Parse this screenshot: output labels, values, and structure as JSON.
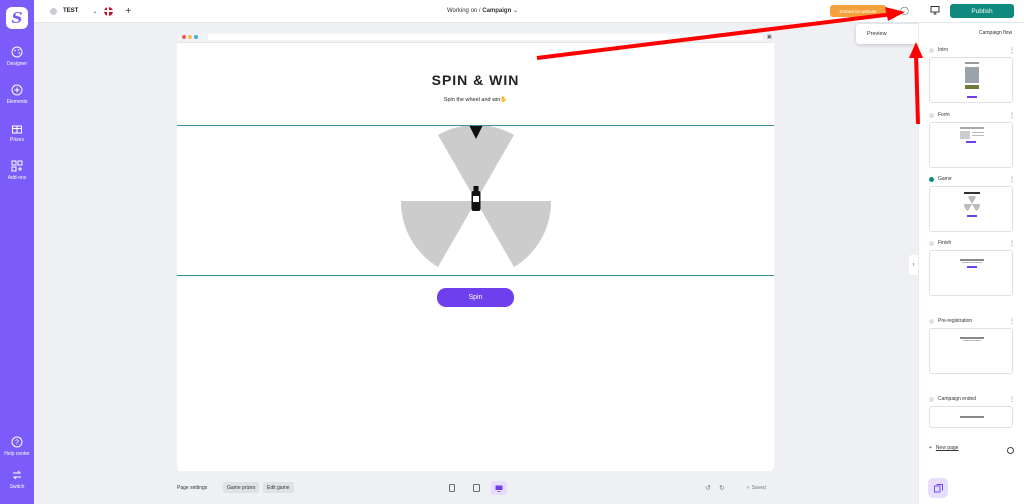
{
  "topbar": {
    "campaign_name": "TEST",
    "working_prefix": "Working on  /",
    "working_page": "Campaign",
    "embed_label": "Embed on website",
    "publish_label": "Publish"
  },
  "sidebar": {
    "items": [
      {
        "label": "Designer",
        "icon": "palette-icon"
      },
      {
        "label": "Elements",
        "icon": "plus-circle-icon"
      },
      {
        "label": "Prizes",
        "icon": "gift-icon"
      },
      {
        "label": "Add-ons",
        "icon": "grid-plus-icon"
      }
    ],
    "bottom": [
      {
        "label": "Help center",
        "icon": "help-icon"
      },
      {
        "label": "Switch",
        "icon": "switch-icon"
      }
    ]
  },
  "preview_menu": {
    "label": "Preview"
  },
  "canvas": {
    "title": "SPIN & WIN",
    "subtitle": "Spin the wheel and win✋",
    "spin_label": "Spin"
  },
  "right_panel": {
    "title": "Campaign flow",
    "items": [
      {
        "name": "Intro",
        "active": false
      },
      {
        "name": "Form",
        "active": false
      },
      {
        "name": "Game",
        "active": true
      },
      {
        "name": "Finish",
        "active": false
      },
      {
        "name": "Pre-registration",
        "active": false
      },
      {
        "name": "Campaign ended",
        "active": false
      }
    ],
    "new_page": "New page"
  },
  "bottombar": {
    "page_settings": "Page settings",
    "game_prizes": "Game prizes",
    "edit_game": "Edit game",
    "saved": "Saved"
  },
  "colors": {
    "sidebar": "#7b5cfa",
    "publish": "#108a7e",
    "embed": "#f4a13c",
    "spin": "#6e3fec",
    "annotation": "#ff0000"
  }
}
